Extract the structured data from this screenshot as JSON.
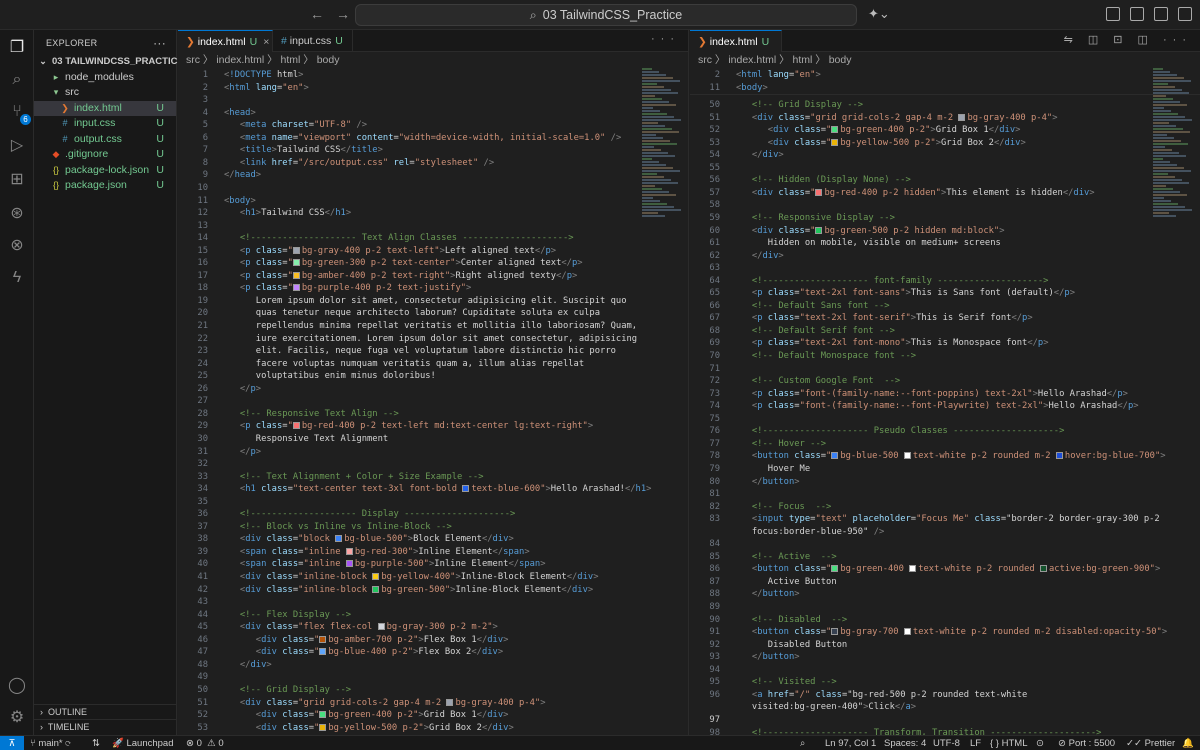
{
  "titlebar": {
    "search": "03 TailwindCSS_Practice"
  },
  "sidebar": {
    "title": "EXPLORER",
    "project": "03 TAILWINDCSS_PRACTICE",
    "items": [
      {
        "label": "node_modules",
        "indent": 1,
        "icon": "folder-icon",
        "badge": ""
      },
      {
        "label": "src",
        "indent": 1,
        "icon": "folder-open-icon",
        "badge": ""
      },
      {
        "label": "index.html",
        "indent": 2,
        "icon": "html-file-icon",
        "badge": "U",
        "selected": true
      },
      {
        "label": "input.css",
        "indent": 2,
        "icon": "css-file-icon",
        "badge": "U"
      },
      {
        "label": "output.css",
        "indent": 2,
        "icon": "css-file-icon",
        "badge": "U"
      },
      {
        "label": ".gitignore",
        "indent": 1,
        "icon": "git-icon",
        "badge": "U"
      },
      {
        "label": "package-lock.json",
        "indent": 1,
        "icon": "json-icon",
        "badge": "U"
      },
      {
        "label": "package.json",
        "indent": 1,
        "icon": "json-icon",
        "badge": "U"
      }
    ],
    "outline": "OUTLINE",
    "timeline": "TIMELINE"
  },
  "left_editor": {
    "tabs": [
      {
        "label": "index.html",
        "badge": "U",
        "active": true
      },
      {
        "label": "input.css",
        "badge": "U",
        "active": false
      }
    ],
    "breadcrumb": "src  〉  index.html  〉  html  〉  body",
    "lines": [
      {
        "n": "1",
        "t": "<!DOCTYPE html>"
      },
      {
        "n": "2",
        "t": "<html lang=\"en\">"
      },
      {
        "n": "3",
        "t": ""
      },
      {
        "n": "4",
        "t": "<head>"
      },
      {
        "n": "5",
        "t": "   <meta charset=\"UTF-8\" />"
      },
      {
        "n": "6",
        "t": "   <meta name=\"viewport\" content=\"width=device-width, initial-scale=1.0\" />"
      },
      {
        "n": "7",
        "t": "   <title>Tailwind CSS</title>"
      },
      {
        "n": "8",
        "t": "   <link href=\"/src/output.css\" rel=\"stylesheet\" />"
      },
      {
        "n": "9",
        "t": "</head>"
      },
      {
        "n": "10",
        "t": ""
      },
      {
        "n": "11",
        "t": "<body>"
      },
      {
        "n": "12",
        "t": "   <h1>Tailwind CSS</h1>"
      },
      {
        "n": "13",
        "t": ""
      },
      {
        "n": "14",
        "t": "   <!-------------------- Text Align Classes -------------------->"
      },
      {
        "n": "15",
        "t": "   <p class=\"bg-gray-400 p-2 text-left\">Left aligned text</p>"
      },
      {
        "n": "16",
        "t": "   <p class=\"bg-green-300 p-2 text-center\">Center aligned text</p>"
      },
      {
        "n": "17",
        "t": "   <p class=\"bg-amber-400 p-2 text-right\">Right aligned texty</p>"
      },
      {
        "n": "18",
        "t": "   <p class=\"bg-purple-400 p-2 text-justify\">"
      },
      {
        "n": "19",
        "t": "      Lorem ipsum dolor sit amet, consectetur adipisicing elit. Suscipit quo"
      },
      {
        "n": "20",
        "t": "      quas tenetur neque architecto laborum? Cupiditate soluta ex culpa"
      },
      {
        "n": "21",
        "t": "      repellendus minima repellat veritatis et mollitia illo laboriosam? Quam,"
      },
      {
        "n": "22",
        "t": "      iure exercitationem. Lorem ipsum dolor sit amet consectetur, adipisicing"
      },
      {
        "n": "23",
        "t": "      elit. Facilis, neque fuga vel voluptatum labore distinctio hic porro"
      },
      {
        "n": "24",
        "t": "      facere voluptas numquam veritatis quam a, illum alias repellat"
      },
      {
        "n": "25",
        "t": "      voluptatibus enim minus doloribus!"
      },
      {
        "n": "26",
        "t": "   </p>"
      },
      {
        "n": "27",
        "t": ""
      },
      {
        "n": "28",
        "t": "   <!-- Responsive Text Align -->"
      },
      {
        "n": "29",
        "t": "   <p class=\"bg-red-400 p-2 text-left md:text-center lg:text-right\">"
      },
      {
        "n": "30",
        "t": "      Responsive Text Alignment"
      },
      {
        "n": "31",
        "t": "   </p>"
      },
      {
        "n": "32",
        "t": ""
      },
      {
        "n": "33",
        "t": "   <!-- Text Alignment + Color + Size Example -->"
      },
      {
        "n": "34",
        "t": "   <h1 class=\"text-center text-3xl font-bold text-blue-600\">Hello Arashad!</h1>"
      },
      {
        "n": "35",
        "t": ""
      },
      {
        "n": "36",
        "t": "   <!-------------------- Display -------------------->"
      },
      {
        "n": "37",
        "t": "   <!-- Block vs Inline vs Inline-Block -->"
      },
      {
        "n": "38",
        "t": "   <div class=\"block bg-blue-500\">Block Element</div>"
      },
      {
        "n": "39",
        "t": "   <span class=\"inline bg-red-300\">Inline Element</span>"
      },
      {
        "n": "40",
        "t": "   <span class=\"inline bg-purple-500\">Inline Element</span>"
      },
      {
        "n": "41",
        "t": "   <div class=\"inline-block bg-yellow-400\">Inline-Block Element</div>"
      },
      {
        "n": "42",
        "t": "   <div class=\"inline-block bg-green-500\">Inline-Block Element</div>"
      },
      {
        "n": "43",
        "t": ""
      },
      {
        "n": "44",
        "t": "   <!-- Flex Display -->"
      },
      {
        "n": "45",
        "t": "   <div class=\"flex flex-col bg-gray-300 p-2 m-2\">"
      },
      {
        "n": "46",
        "t": "      <div class=\"bg-amber-700 p-2\">Flex Box 1</div>"
      },
      {
        "n": "47",
        "t": "      <div class=\"bg-blue-400 p-2\">Flex Box 2</div>"
      },
      {
        "n": "48",
        "t": "   </div>"
      },
      {
        "n": "49",
        "t": ""
      },
      {
        "n": "50",
        "t": "   <!-- Grid Display -->"
      },
      {
        "n": "51",
        "t": "   <div class=\"grid grid-cols-2 gap-4 m-2 bg-gray-400 p-4\">"
      },
      {
        "n": "52",
        "t": "      <div class=\"bg-green-400 p-2\">Grid Box 1</div>"
      },
      {
        "n": "53",
        "t": "      <div class=\"bg-yellow-500 p-2\">Grid Box 2</div>"
      }
    ]
  },
  "right_editor": {
    "tabs": [
      {
        "label": "index.html",
        "badge": "U",
        "active": true
      }
    ],
    "breadcrumb": "src  〉  index.html  〉  html  〉  body",
    "sticky": [
      {
        "n": "2",
        "t": "<html lang=\"en\">"
      },
      {
        "n": "11",
        "t": "<body>"
      }
    ],
    "lines": [
      {
        "n": "50",
        "t": "   <!-- Grid Display -->"
      },
      {
        "n": "51",
        "t": "   <div class=\"grid grid-cols-2 gap-4 m-2 bg-gray-400 p-4\">"
      },
      {
        "n": "52",
        "t": "      <div class=\"bg-green-400 p-2\">Grid Box 1</div>"
      },
      {
        "n": "53",
        "t": "      <div class=\"bg-yellow-500 p-2\">Grid Box 2</div>"
      },
      {
        "n": "54",
        "t": "   </div>"
      },
      {
        "n": "55",
        "t": ""
      },
      {
        "n": "56",
        "t": "   <!-- Hidden (Display None) -->"
      },
      {
        "n": "57",
        "t": "   <div class=\"bg-red-400 p-2 hidden\">This element is hidden</div>"
      },
      {
        "n": "58",
        "t": ""
      },
      {
        "n": "59",
        "t": "   <!-- Responsive Display -->"
      },
      {
        "n": "60",
        "t": "   <div class=\"bg-green-500 p-2 hidden md:block\">"
      },
      {
        "n": "61",
        "t": "      Hidden on mobile, visible on medium+ screens"
      },
      {
        "n": "62",
        "t": "   </div>"
      },
      {
        "n": "63",
        "t": ""
      },
      {
        "n": "64",
        "t": "   <!-------------------- font-family -------------------->"
      },
      {
        "n": "65",
        "t": "   <p class=\"text-2xl font-sans\">This is Sans font (default)</p>"
      },
      {
        "n": "66",
        "t": "   <!-- Default Sans font -->"
      },
      {
        "n": "67",
        "t": "   <p class=\"text-2xl font-serif\">This is Serif font</p>"
      },
      {
        "n": "68",
        "t": "   <!-- Default Serif font -->"
      },
      {
        "n": "69",
        "t": "   <p class=\"text-2xl font-mono\">This is Monospace font</p>"
      },
      {
        "n": "70",
        "t": "   <!-- Default Monospace font -->"
      },
      {
        "n": "71",
        "t": ""
      },
      {
        "n": "72",
        "t": "   <!-- Custom Google Font  -->"
      },
      {
        "n": "73",
        "t": "   <p class=\"font-(family-name:--font-poppins) text-2xl\">Hello Arashad</p>"
      },
      {
        "n": "74",
        "t": "   <p class=\"font-(family-name:--font-Playwrite) text-2xl\">Hello Arashad</p>"
      },
      {
        "n": "75",
        "t": ""
      },
      {
        "n": "76",
        "t": "   <!-------------------- Pseudo Classes -------------------->"
      },
      {
        "n": "77",
        "t": "   <!-- Hover -->"
      },
      {
        "n": "78",
        "t": "   <button class=\"bg-blue-500 text-white p-2 rounded m-2 hover:bg-blue-700\">"
      },
      {
        "n": "79",
        "t": "      Hover Me"
      },
      {
        "n": "80",
        "t": "   </button>"
      },
      {
        "n": "81",
        "t": ""
      },
      {
        "n": "82",
        "t": "   <!-- Focus  -->"
      },
      {
        "n": "83",
        "t": "   <input type=\"text\" placeholder=\"Focus Me\" class=\"border-2 border-gray-300 p-2"
      },
      {
        "n": "",
        "t": "   focus:border-blue-950\" />"
      },
      {
        "n": "84",
        "t": ""
      },
      {
        "n": "85",
        "t": "   <!-- Active  -->"
      },
      {
        "n": "86",
        "t": "   <button class=\"bg-green-400 text-white p-2 rounded active:bg-green-900\">"
      },
      {
        "n": "87",
        "t": "      Active Button"
      },
      {
        "n": "88",
        "t": "   </button>"
      },
      {
        "n": "89",
        "t": ""
      },
      {
        "n": "90",
        "t": "   <!-- Disabled  -->"
      },
      {
        "n": "91",
        "t": "   <button class=\"bg-gray-700 text-white p-2 rounded m-2 disabled:opacity-50\">"
      },
      {
        "n": "92",
        "t": "      Disabled Button"
      },
      {
        "n": "93",
        "t": "   </button>"
      },
      {
        "n": "94",
        "t": ""
      },
      {
        "n": "95",
        "t": "   <!-- Visited -->"
      },
      {
        "n": "96",
        "t": "   <a href=\"/\" class=\"bg-red-500 p-2 rounded text-white"
      },
      {
        "n": "",
        "t": "   visited:bg-green-400\">Click</a>"
      },
      {
        "n": "97",
        "t": "",
        "cur": true
      },
      {
        "n": "98",
        "t": "   <!-------------------- Transform, Transition -------------------->"
      }
    ]
  },
  "statusbar": {
    "branch": "main*",
    "launchpad": "Launchpad",
    "problems": "0  ⚠ 0",
    "position": "Ln 97, Col 1",
    "spaces": "Spaces: 4",
    "encoding": "UTF-8",
    "eol": "LF",
    "language": "{ } HTML",
    "port": "Port : 5500",
    "prettier": "Prettier"
  }
}
